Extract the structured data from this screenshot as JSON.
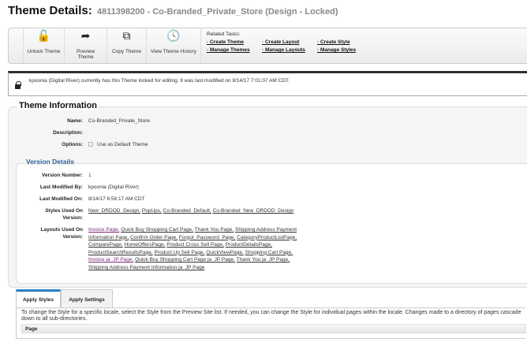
{
  "header": {
    "title": "Theme Details:",
    "subtitle": "4811398200 - Co-Branded_Private_Store (Design - Locked)"
  },
  "toolbar": {
    "buttons": [
      {
        "label": "Unlock Theme",
        "icon": "unlock-icon"
      },
      {
        "label": "Preview Theme",
        "icon": "share-arrow-icon"
      },
      {
        "label": "Copy Theme",
        "icon": "copy-icon"
      },
      {
        "label": "View Theme History",
        "icon": "clock-icon"
      }
    ],
    "related_label": "Related Tasks:",
    "related": [
      "Create Theme",
      "Manage Themes",
      "Create Layout",
      "Manage Layouts",
      "Create Style",
      "Manage Styles"
    ]
  },
  "notice": {
    "text": "kpoonia (Digital River) currently has this Theme locked for editing. It was last modified on 8/14/17 7:01:07 AM CDT.",
    "icon": "lock-icon"
  },
  "theme_info": {
    "legend": "Theme Information",
    "name_label": "Name:",
    "name": "Co-Branded_Private_Store",
    "description_label": "Description:",
    "options_label": "Options:",
    "default_option": "Use as Default Theme",
    "default_checked": false
  },
  "version": {
    "legend": "Version Details",
    "number_label": "Version Number:",
    "number": "1",
    "modified_by_label": "Last Modified By:",
    "modified_by": "kpoonia (Digital River)",
    "modified_on_label": "Last Modified On:",
    "modified_on": "8/14/17 6:56:17 AM CDT",
    "styles_label": "Styles Used On Version:",
    "styles": [
      "New_DRDOD_Design,",
      "PopUps,",
      "Co-Branded_Default,",
      "Co-Branded_New_DRDOD_Design"
    ],
    "layouts_label": "Layouts Used On Version:",
    "layouts": [
      "Invoice Page,",
      "Quick Buy Shopping Cart Page,",
      "Thank You Page,",
      "Shipping Address Payment Information Page,",
      "Confirm Order Page,",
      "Forgot_Password_Page,",
      "CategoryProductListPage,",
      "ComparePage,",
      "HomeOffersPage,",
      "Product Cross Sell Page,",
      "ProductDetailsPage,",
      "ProductSearchResultsPage,",
      "Product Up Sell Page,",
      "QuickViewPage,",
      "Shopping Cart Page,",
      "Invoice ja_JP Page,",
      "Quick Buy Shopping Cart Page ja_JP Page,",
      "Thank You ja_JP Page,",
      "Shipping Address Payment Information ja_JP Page"
    ]
  },
  "tabs": [
    {
      "label": "Apply Styles",
      "active": true
    },
    {
      "label": "Apply Settings",
      "active": false
    }
  ],
  "panel": {
    "text": "To change the Style for a specific locale, select the Style from the Preview Site list. If needed, you can change the Style for individual pages within the locale. Changes made to a directory of pages cascade down to all sub-directories.",
    "column": "Page"
  }
}
